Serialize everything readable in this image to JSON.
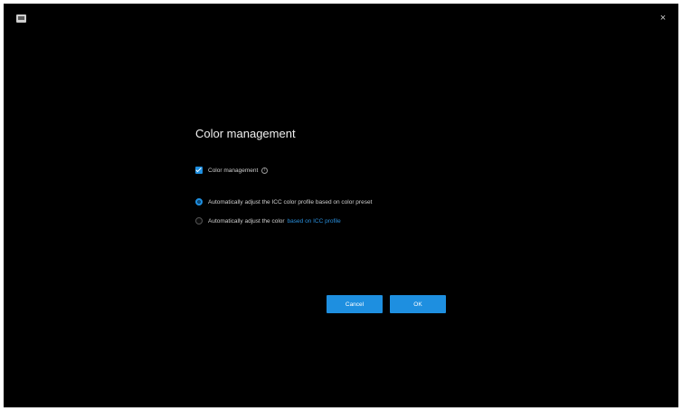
{
  "window": {
    "app_icon": "monitor-icon",
    "close_glyph": "×"
  },
  "dialog": {
    "title": "Color management",
    "color_management": {
      "label": "Color management",
      "checked": true,
      "info_glyph": "i"
    },
    "options": [
      {
        "label": "Automatically adjust the ICC color profile based on color preset",
        "selected": true
      },
      {
        "label": "Automatically adjust the color",
        "link_text": "based on ICC profile",
        "selected": false
      }
    ],
    "buttons": {
      "cancel_label": "Cancel",
      "ok_label": "OK"
    }
  },
  "colors": {
    "background": "#000000",
    "accent": "#1e8fe0",
    "link": "#2a8fdc"
  }
}
